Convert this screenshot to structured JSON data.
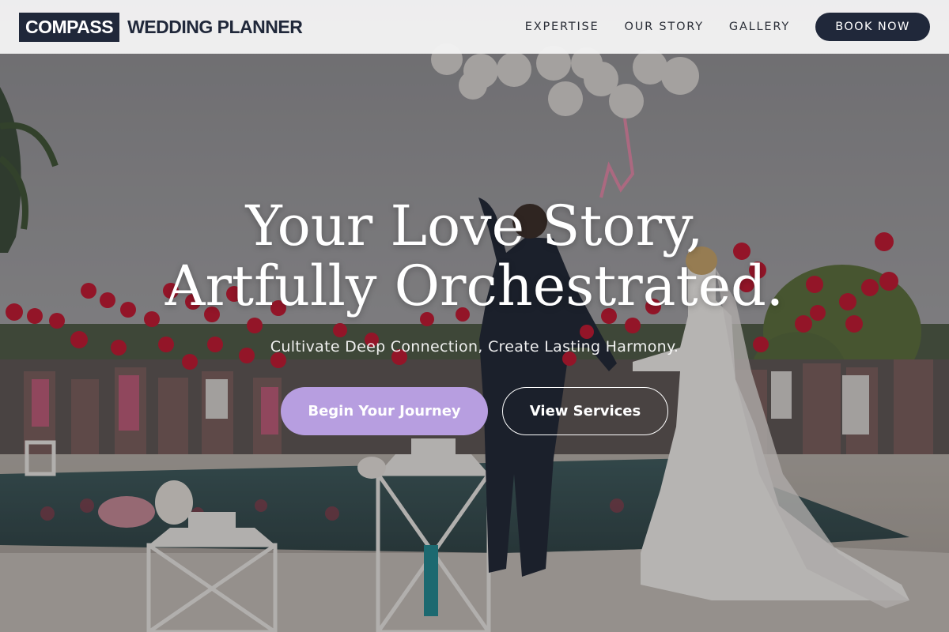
{
  "brand": {
    "logo_box_text": "COMPASS",
    "logo_text": "WEDDING PLANNER",
    "primary_color": "#20283a",
    "accent_color": "#b79ee0"
  },
  "nav": {
    "links": [
      "EXPERTISE",
      "OUR STORY",
      "GALLERY"
    ],
    "cta_label": "BOOK NOW"
  },
  "hero": {
    "headline_line1": "Your Love Story,",
    "headline_line2": "Artfully Orchestrated.",
    "tagline": "Cultivate Deep Connection, Create Lasting Harmony.",
    "primary_button": "Begin Your Journey",
    "secondary_button": "View Services",
    "background_image": "wedding-couple-balloons-photo"
  }
}
